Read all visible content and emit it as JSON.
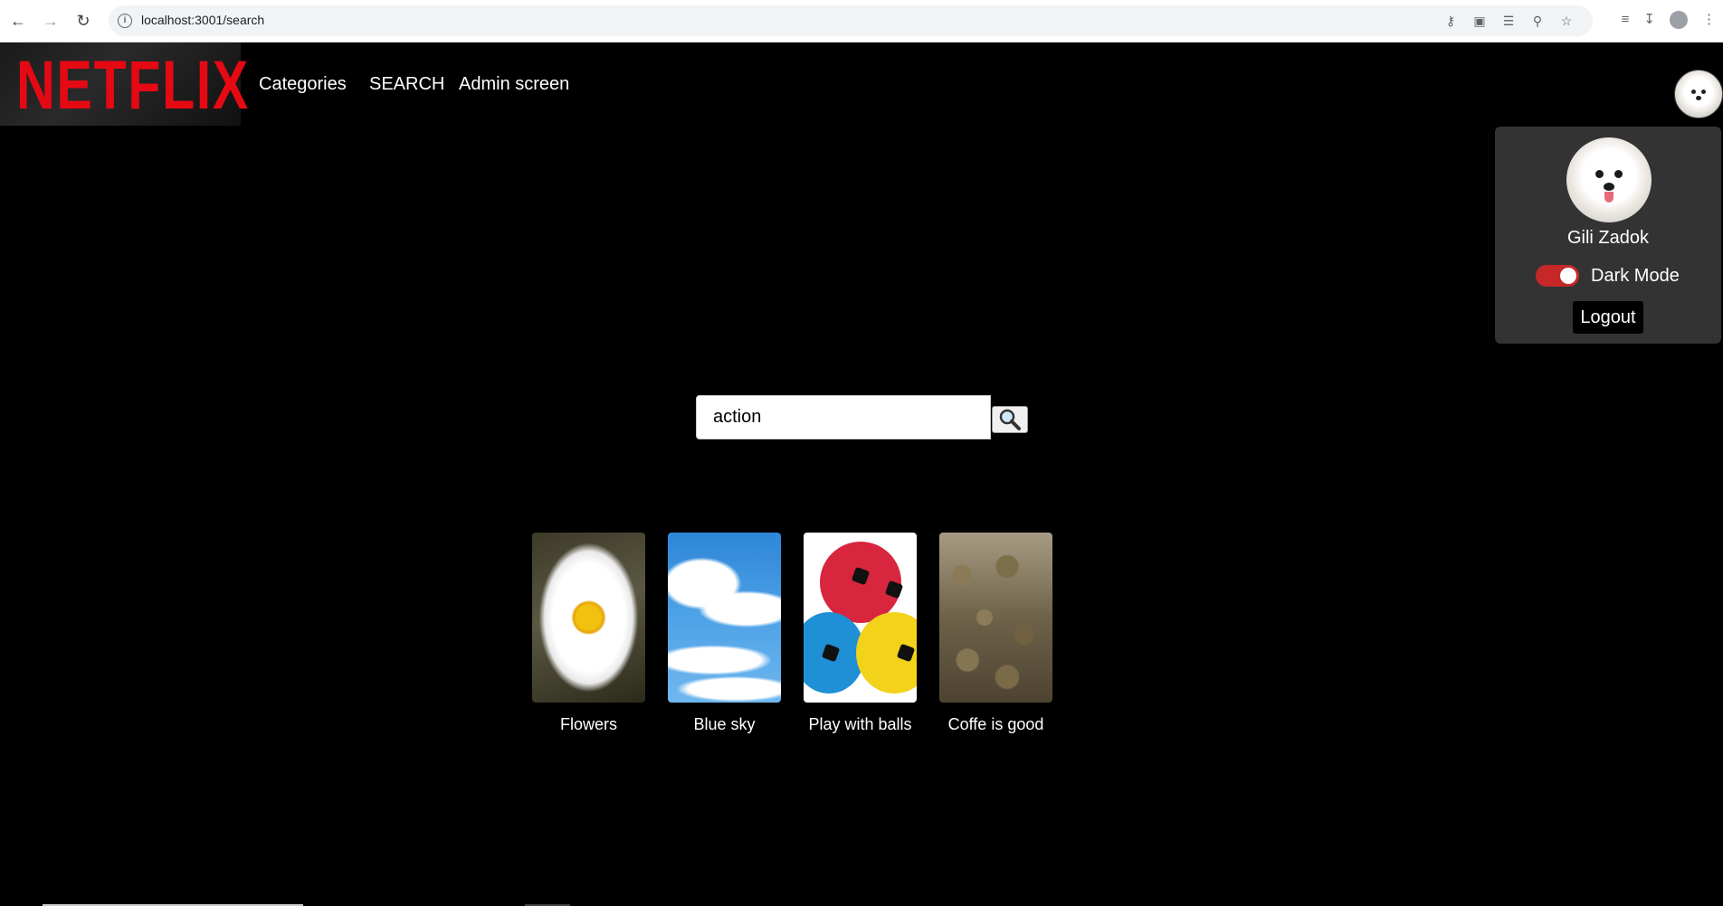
{
  "browser": {
    "url": "localhost:3001/search"
  },
  "header": {
    "logo": "NETFLIX",
    "nav": [
      "Categories",
      "SEARCH",
      "Admin screen"
    ]
  },
  "profile_menu": {
    "username": "Gili Zadok",
    "dark_mode_label": "Dark Mode",
    "dark_mode_on": true,
    "logout_label": "Logout"
  },
  "search": {
    "value": "action"
  },
  "results": [
    {
      "title": "Flowers"
    },
    {
      "title": "Blue sky"
    },
    {
      "title": "Play with balls"
    },
    {
      "title": "Coffe is good"
    }
  ],
  "colors": {
    "brand": "#e50914",
    "toggle": "#c62828",
    "background": "#000000"
  }
}
